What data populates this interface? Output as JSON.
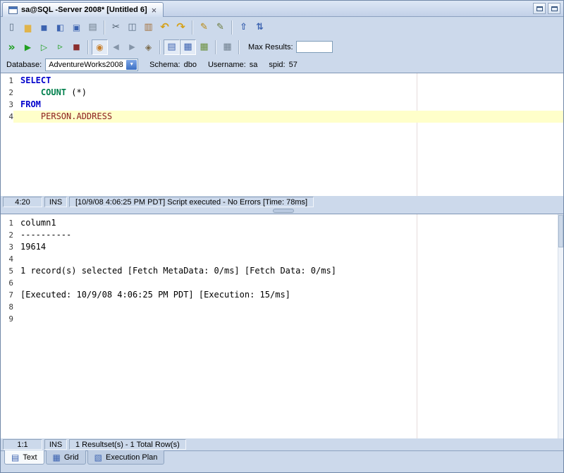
{
  "window": {
    "tab": {
      "title": "sa@SQL -Server 2008* [Untitled 6]",
      "close_label": "×"
    }
  },
  "toolbar_main": {
    "items": [
      {
        "name": "new-file-button",
        "icon": "new-file-icon"
      },
      {
        "name": "open-file-button",
        "icon": "open-folder-icon"
      },
      {
        "name": "save-button",
        "icon": "save-icon"
      },
      {
        "name": "save-all-button",
        "icon": "save-all-icon"
      },
      {
        "name": "save-as-button",
        "icon": "save-as-icon"
      },
      {
        "name": "print-button",
        "icon": "print-icon"
      },
      {
        "separator": true
      },
      {
        "name": "cut-button",
        "icon": "cut-icon"
      },
      {
        "name": "copy-button",
        "icon": "copy-icon"
      },
      {
        "name": "paste-button",
        "icon": "paste-icon"
      },
      {
        "name": "undo-button",
        "icon": "undo-icon"
      },
      {
        "name": "redo-button",
        "icon": "redo-icon"
      },
      {
        "separator": true
      },
      {
        "name": "format-sql-button",
        "icon": "format-sql-icon"
      },
      {
        "name": "edit-options-button",
        "icon": "edit-options-icon"
      },
      {
        "separator": true
      },
      {
        "name": "uppercase-button",
        "icon": "uppercase-icon"
      },
      {
        "name": "sort-button",
        "icon": "sort-icon"
      }
    ]
  },
  "toolbar_run": {
    "items": [
      {
        "name": "execute-all-button",
        "icon": "execute-all-icon"
      },
      {
        "name": "execute-button",
        "icon": "execute-icon"
      },
      {
        "name": "execute-selection-button",
        "icon": "execute-selection-icon"
      },
      {
        "name": "execute-current-button",
        "icon": "execute-current-icon"
      },
      {
        "name": "stop-button",
        "icon": "stop-icon"
      },
      {
        "separator": true
      },
      {
        "name": "pin-session-toggle",
        "icon": "pin-icon",
        "pressed": true
      },
      {
        "name": "previous-statement-button",
        "icon": "previous-icon"
      },
      {
        "name": "next-statement-button",
        "icon": "next-icon"
      },
      {
        "name": "commit-button",
        "icon": "commit-icon"
      },
      {
        "separator": true
      },
      {
        "name": "results-as-text-toggle",
        "icon": "results-text-icon",
        "pressed": true
      },
      {
        "name": "results-as-grid-toggle",
        "icon": "results-grid-icon",
        "pressed": true
      },
      {
        "name": "results-pin-toggle",
        "icon": "results-pin-icon"
      },
      {
        "separator": true
      },
      {
        "name": "open-result-window-button",
        "icon": "result-window-icon"
      }
    ],
    "max_results_label": "Max Results:",
    "max_results_value": ""
  },
  "context_bar": {
    "database_label": "Database:",
    "database_value": "AdventureWorks2008",
    "dropdown_glyph": "▼",
    "schema_label": "Schema:",
    "schema_value": "dbo",
    "username_label": "Username:",
    "username_value": "sa",
    "spid_label": "spid:",
    "spid_value": "57"
  },
  "editor": {
    "colors": {
      "keyword": "#0000cc",
      "function": "#00804d",
      "identifier": "#8b1d1d",
      "plain": "#000000"
    },
    "current_line_color": "#ffffca",
    "lines": [
      {
        "num": "1",
        "current": false,
        "segments": [
          {
            "text": "SELECT",
            "color": "keyword"
          }
        ]
      },
      {
        "num": "2",
        "current": false,
        "segments": [
          {
            "text": "    ",
            "color": "plain"
          },
          {
            "text": "COUNT",
            "color": "function"
          },
          {
            "text": " (*)",
            "color": "plain"
          }
        ]
      },
      {
        "num": "3",
        "current": false,
        "segments": [
          {
            "text": "FROM",
            "color": "keyword"
          }
        ]
      },
      {
        "num": "4",
        "current": true,
        "segments": [
          {
            "text": "    ",
            "color": "plain"
          },
          {
            "text": "PERSON.ADDRESS",
            "color": "identifier"
          }
        ]
      }
    ]
  },
  "editor_status": {
    "position": "4:20",
    "mode": "INS",
    "message": "[10/9/08 4:06:25 PM PDT] Script executed - No Errors [Time: 78ms]"
  },
  "results": {
    "lines": [
      {
        "num": "1",
        "text": "column1"
      },
      {
        "num": "2",
        "text": "----------"
      },
      {
        "num": "3",
        "text": "19614"
      },
      {
        "num": "4",
        "text": ""
      },
      {
        "num": "5",
        "text": "1 record(s) selected [Fetch MetaData: 0/ms] [Fetch Data: 0/ms]"
      },
      {
        "num": "6",
        "text": ""
      },
      {
        "num": "7",
        "text": "[Executed: 10/9/08 4:06:25 PM PDT] [Execution: 15/ms]"
      },
      {
        "num": "8",
        "text": ""
      },
      {
        "num": "9",
        "text": ""
      }
    ]
  },
  "results_status": {
    "position": "1:1",
    "mode": "INS",
    "message": "1 Resultset(s) - 1 Total Row(s)"
  },
  "bottom_tabs": [
    {
      "name": "tab-text",
      "label": "Text",
      "icon": "text-tab-icon",
      "active": true
    },
    {
      "name": "tab-grid",
      "label": "Grid",
      "icon": "grid-tab-icon",
      "active": false
    },
    {
      "name": "tab-execution-plan",
      "label": "Execution Plan",
      "icon": "execution-plan-icon",
      "active": false
    }
  ]
}
